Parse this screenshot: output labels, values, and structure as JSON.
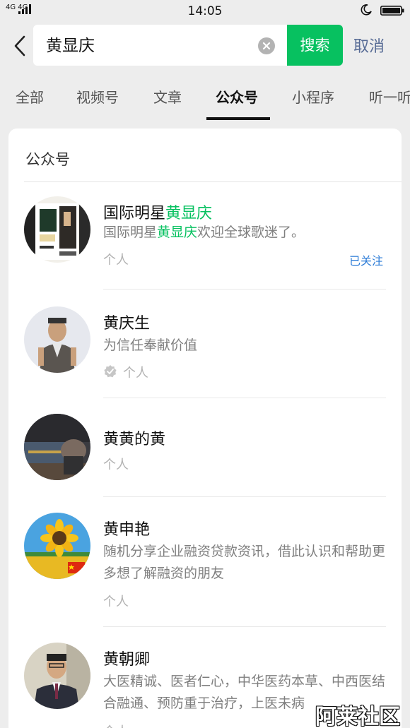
{
  "status_bar": {
    "network": "4G 4G",
    "time": "14:05"
  },
  "search": {
    "query": "黄显庆",
    "search_label": "搜索",
    "cancel_label": "取消"
  },
  "tabs": [
    {
      "label": "全部"
    },
    {
      "label": "视频号"
    },
    {
      "label": "文章"
    },
    {
      "label": "公众号",
      "active": true
    },
    {
      "label": "小程序"
    },
    {
      "label": "听一听"
    }
  ],
  "section_title": "公众号",
  "accounts": [
    {
      "name_prefix": "国际明星",
      "name_highlight": "黄显庆",
      "desc_prefix": "国际明星",
      "desc_highlight": "黄显庆",
      "desc_suffix": "欢迎全球歌迷了。",
      "type": "个人",
      "follow_status": "已关注",
      "avatar": "poster-avatar"
    },
    {
      "name": "黄庆生",
      "desc": "为信任奉献价值",
      "type": "个人",
      "verified": true,
      "avatar": "person-avatar"
    },
    {
      "name": "黄黄的黄",
      "type": "个人",
      "avatar": "room-avatar"
    },
    {
      "name": "黄申艳",
      "desc": "随机分享企业融资贷款资讯，借此认识和帮助更多想了解融资的朋友",
      "type": "个人",
      "avatar": "sunflower-avatar"
    },
    {
      "name": "黄朝卿",
      "desc": "大医精诚、医者仁心，中华医药本草、中西医结合融通、预防重于治疗，上医未病",
      "type": "个人",
      "avatar": "doctor-avatar"
    }
  ],
  "watermark": "阿莱社区",
  "colors": {
    "accent": "#07c160",
    "link": "#576b95",
    "follow": "#2a7ad6",
    "background": "#ededed"
  }
}
